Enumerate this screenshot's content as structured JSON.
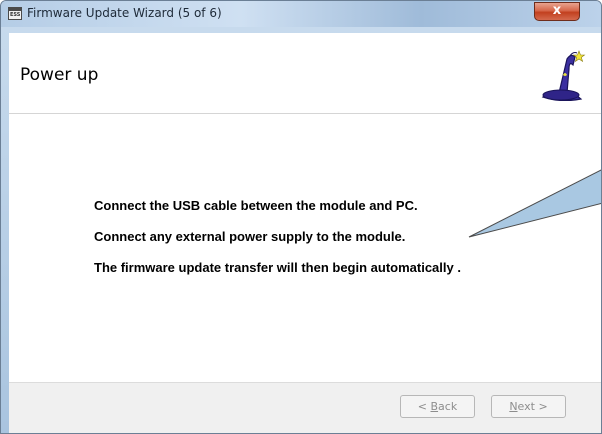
{
  "window": {
    "title": "Firmware Update Wizard (5 of 6)",
    "icon_text": "ESS",
    "close_label": "x"
  },
  "header": {
    "title": "Power up"
  },
  "instructions": [
    "Connect the USB cable between the module and PC.",
    "Connect any external power supply to the module.",
    "The firmware update transfer will then begin automatically ."
  ],
  "footer": {
    "back_accesskey": "B",
    "back_rest": "ack",
    "back_prefix": "< ",
    "next_accesskey": "N",
    "next_rest": "ext >"
  },
  "colors": {
    "callout_fill": "#a9c8e2",
    "disabled_text": "#8d8d8d"
  },
  "icons": {
    "wizard": "wizard-hat-icon",
    "close": "close-icon",
    "app": "app-icon"
  }
}
